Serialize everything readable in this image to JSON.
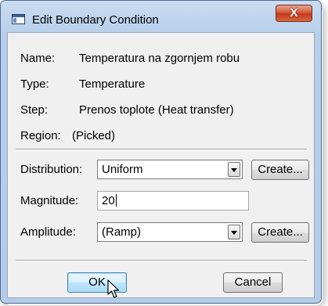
{
  "window": {
    "title": "Edit Boundary Condition",
    "close_glyph": "X"
  },
  "info": {
    "name_label": "Name:",
    "name_value": "Temperatura na zgornjem robu",
    "type_label": "Type:",
    "type_value": "Temperature",
    "step_label": "Step:",
    "step_value": "Prenos toplote (Heat transfer)",
    "region_label": "Region:",
    "region_value": "(Picked)"
  },
  "form": {
    "distribution_label": "Distribution:",
    "distribution_value": "Uniform",
    "distribution_create": "Create...",
    "magnitude_label": "Magnitude:",
    "magnitude_value": "20",
    "amplitude_label": "Amplitude:",
    "amplitude_value": "(Ramp)",
    "amplitude_create": "Create..."
  },
  "buttons": {
    "ok": "OK",
    "cancel": "Cancel"
  },
  "icons": {
    "window_icon": "window-icon",
    "close": "close-icon",
    "dropdown": "chevron-down-icon",
    "cursor": "mouse-pointer-icon"
  },
  "colors": {
    "title_bar": "#b7cfea",
    "close_button": "#c2391c",
    "default_button": "#bee6fd"
  }
}
